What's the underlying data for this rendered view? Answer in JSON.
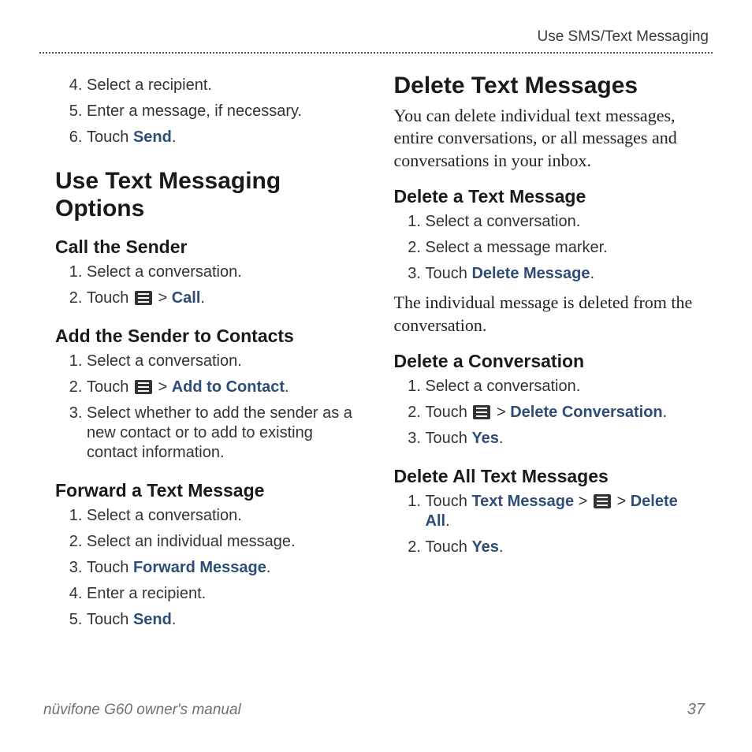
{
  "runningHead": "Use SMS/Text Messaging",
  "footerLeft": "nüvifone G60 owner's manual",
  "pageNumber": "37",
  "left": {
    "continuedList": {
      "start": 4,
      "items": [
        [
          {
            "t": "text",
            "v": "Select a recipient."
          }
        ],
        [
          {
            "t": "text",
            "v": "Enter a message, if necessary."
          }
        ],
        [
          {
            "t": "text",
            "v": "Touch "
          },
          {
            "t": "action",
            "v": "Send"
          },
          {
            "t": "text",
            "v": "."
          }
        ]
      ]
    },
    "h2": "Use Text Messaging Options",
    "sections": [
      {
        "h3": "Call the Sender",
        "ol": [
          [
            {
              "t": "text",
              "v": "Select a conversation."
            }
          ],
          [
            {
              "t": "text",
              "v": "Touch "
            },
            {
              "t": "icon"
            },
            {
              "t": "text",
              "v": " > "
            },
            {
              "t": "action",
              "v": "Call"
            },
            {
              "t": "text",
              "v": "."
            }
          ]
        ]
      },
      {
        "h3": "Add the Sender to Contacts",
        "ol": [
          [
            {
              "t": "text",
              "v": "Select a conversation."
            }
          ],
          [
            {
              "t": "text",
              "v": "Touch "
            },
            {
              "t": "icon"
            },
            {
              "t": "text",
              "v": " > "
            },
            {
              "t": "action",
              "v": "Add to Contact"
            },
            {
              "t": "text",
              "v": "."
            }
          ],
          [
            {
              "t": "text",
              "v": "Select whether to add the sender as a new contact or to add to existing contact information."
            }
          ]
        ]
      },
      {
        "h3": "Forward a Text Message",
        "ol": [
          [
            {
              "t": "text",
              "v": "Select a conversation."
            }
          ],
          [
            {
              "t": "text",
              "v": "Select an individual message."
            }
          ],
          [
            {
              "t": "text",
              "v": "Touch "
            },
            {
              "t": "action",
              "v": "Forward Message"
            },
            {
              "t": "text",
              "v": "."
            }
          ],
          [
            {
              "t": "text",
              "v": "Enter a recipient."
            }
          ],
          [
            {
              "t": "text",
              "v": "Touch "
            },
            {
              "t": "action",
              "v": "Send"
            },
            {
              "t": "text",
              "v": "."
            }
          ]
        ]
      }
    ]
  },
  "right": {
    "h2": "Delete Text Messages",
    "intro": "You can delete individual text messages, entire conversations, or all messages and conversations in your inbox.",
    "sections": [
      {
        "h3": "Delete a Text Message",
        "ol": [
          [
            {
              "t": "text",
              "v": "Select a conversation."
            }
          ],
          [
            {
              "t": "text",
              "v": "Select a message marker."
            }
          ],
          [
            {
              "t": "text",
              "v": "Touch "
            },
            {
              "t": "action",
              "v": "Delete Message"
            },
            {
              "t": "text",
              "v": "."
            }
          ]
        ],
        "after": "The individual message is deleted from the conversation."
      },
      {
        "h3": "Delete a Conversation",
        "ol": [
          [
            {
              "t": "text",
              "v": "Select a conversation."
            }
          ],
          [
            {
              "t": "text",
              "v": "Touch "
            },
            {
              "t": "icon"
            },
            {
              "t": "text",
              "v": " > "
            },
            {
              "t": "action",
              "v": "Delete Conversation"
            },
            {
              "t": "text",
              "v": "."
            }
          ],
          [
            {
              "t": "text",
              "v": "Touch "
            },
            {
              "t": "action",
              "v": "Yes"
            },
            {
              "t": "text",
              "v": "."
            }
          ]
        ]
      },
      {
        "h3": "Delete All Text Messages",
        "ol": [
          [
            {
              "t": "text",
              "v": "Touch "
            },
            {
              "t": "action",
              "v": "Text Message"
            },
            {
              "t": "text",
              "v": " > "
            },
            {
              "t": "icon"
            },
            {
              "t": "text",
              "v": " > "
            },
            {
              "t": "action",
              "v": "Delete All"
            },
            {
              "t": "text",
              "v": "."
            }
          ],
          [
            {
              "t": "text",
              "v": "Touch "
            },
            {
              "t": "action",
              "v": "Yes"
            },
            {
              "t": "text",
              "v": "."
            }
          ]
        ]
      }
    ]
  }
}
